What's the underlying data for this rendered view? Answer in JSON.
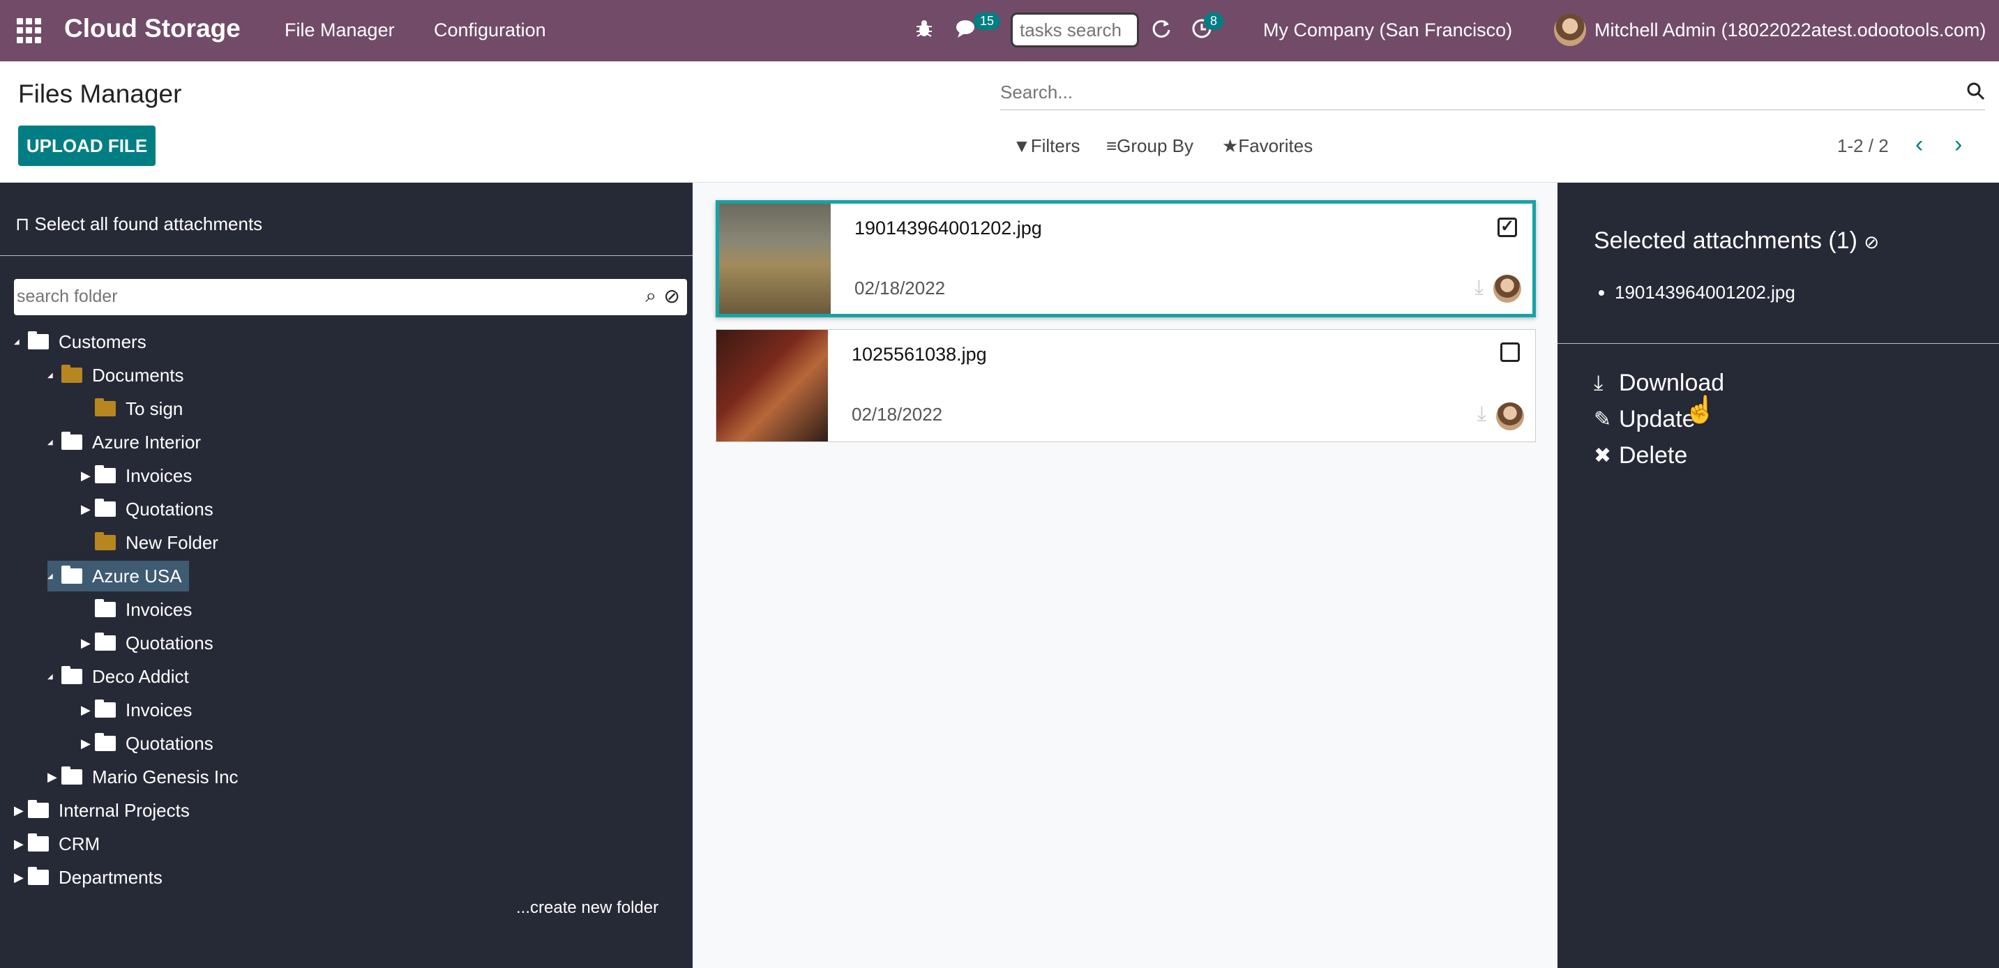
{
  "topbar": {
    "brand": "Cloud Storage",
    "menu": [
      "File Manager",
      "Configuration"
    ],
    "messages_count": "15",
    "tasks_placeholder": "tasks search",
    "activities_count": "8",
    "company": "My Company (San Francisco)",
    "user": "Mitchell Admin (18022022atest.odootools.com)",
    "icons": [
      "apps-icon",
      "bug-icon",
      "chat-icon",
      "refresh-icon",
      "clock-icon"
    ],
    "color": "#714b67"
  },
  "control_panel": {
    "title": "Files Manager",
    "upload_label": "UPLOAD FILE",
    "search_placeholder": "Search...",
    "filters": "Filters",
    "group_by": "Group By",
    "favorites": "Favorites",
    "pager": "1-2 / 2"
  },
  "left": {
    "select_all": "Select all found attachments",
    "folder_search_placeholder": "search folder",
    "create_folder": "...create new folder",
    "tree": [
      {
        "label": "Customers",
        "toggle": "open",
        "color": "#ffffff"
      },
      {
        "label": "Documents",
        "toggle": "open",
        "color": "#b7861f"
      },
      {
        "label": "To sign",
        "toggle": "",
        "color": "#b7861f"
      },
      {
        "label": "Azure Interior",
        "toggle": "open",
        "color": "#ffffff"
      },
      {
        "label": "Invoices",
        "toggle": "closed",
        "color": "#ffffff"
      },
      {
        "label": "Quotations",
        "toggle": "closed",
        "color": "#ffffff"
      },
      {
        "label": "New Folder",
        "toggle": "",
        "color": "#b7861f"
      },
      {
        "label": "Azure USA",
        "toggle": "open",
        "color": "#ffffff"
      },
      {
        "label": "Invoices",
        "toggle": "",
        "color": "#ffffff"
      },
      {
        "label": "Quotations",
        "toggle": "closed",
        "color": "#ffffff"
      },
      {
        "label": "Deco Addict",
        "toggle": "open",
        "color": "#ffffff"
      },
      {
        "label": "Invoices",
        "toggle": "closed",
        "color": "#ffffff"
      },
      {
        "label": "Quotations",
        "toggle": "closed",
        "color": "#ffffff"
      },
      {
        "label": "Mario Genesis Inc",
        "toggle": "closed",
        "color": "#ffffff"
      },
      {
        "label": "Internal Projects",
        "toggle": "closed",
        "color": "#ffffff"
      },
      {
        "label": "CRM",
        "toggle": "closed",
        "color": "#ffffff"
      },
      {
        "label": "Departments",
        "toggle": "closed",
        "color": "#ffffff"
      }
    ]
  },
  "attachments": [
    {
      "name": "190143964001202.jpg",
      "date": "02/18/2022",
      "checked": "true"
    },
    {
      "name": "1025561038.jpg",
      "date": "02/18/2022",
      "checked": "false"
    }
  ],
  "right": {
    "heading": "Selected attachments (1)",
    "selected": [
      "190143964001202.jpg"
    ],
    "actions": [
      "Download",
      "Update",
      "Delete"
    ]
  }
}
